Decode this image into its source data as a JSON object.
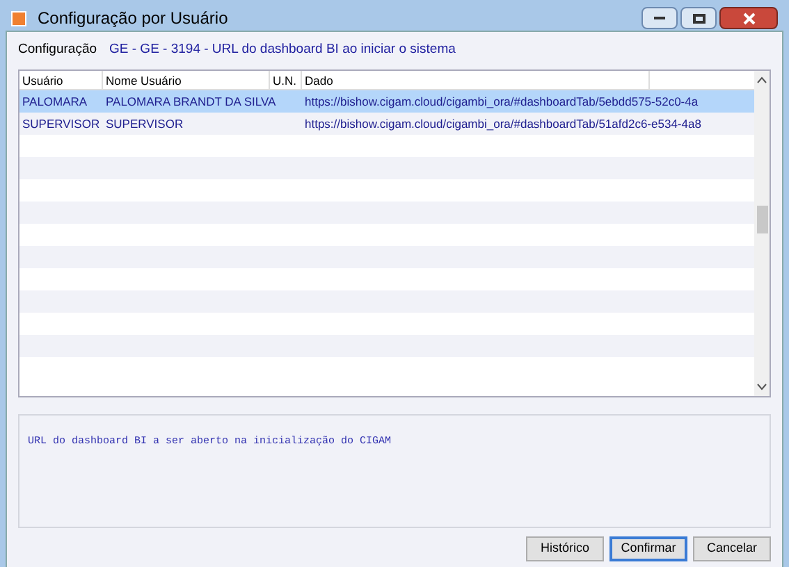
{
  "window": {
    "title": "Configuração por Usuário"
  },
  "config": {
    "label": "Configuração",
    "value": "GE - GE - 3194 - URL do dashboard BI ao iniciar o sistema"
  },
  "table": {
    "columns": [
      "Usuário",
      "Nome Usuário",
      "U.N.",
      "Dado"
    ],
    "rows": [
      {
        "selected": true,
        "cells": [
          "PALOMARA",
          "PALOMARA BRANDT DA SILVA",
          "",
          "https://bishow.cigam.cloud/cigambi_ora/#dashboardTab/5ebdd575-52c0-4a"
        ]
      },
      {
        "selected": false,
        "cells": [
          "SUPERVISOR",
          "SUPERVISOR",
          "",
          "https://bishow.cigam.cloud/cigambi_ora/#dashboardTab/51afd2c6-e534-4a8"
        ]
      }
    ]
  },
  "description": "URL do dashboard BI a ser aberto na inicialização do CIGAM",
  "buttons": [
    {
      "label": "Histórico",
      "default": false
    },
    {
      "label": "Confirmar",
      "default": true
    },
    {
      "label": "Cancelar",
      "default": false
    }
  ]
}
